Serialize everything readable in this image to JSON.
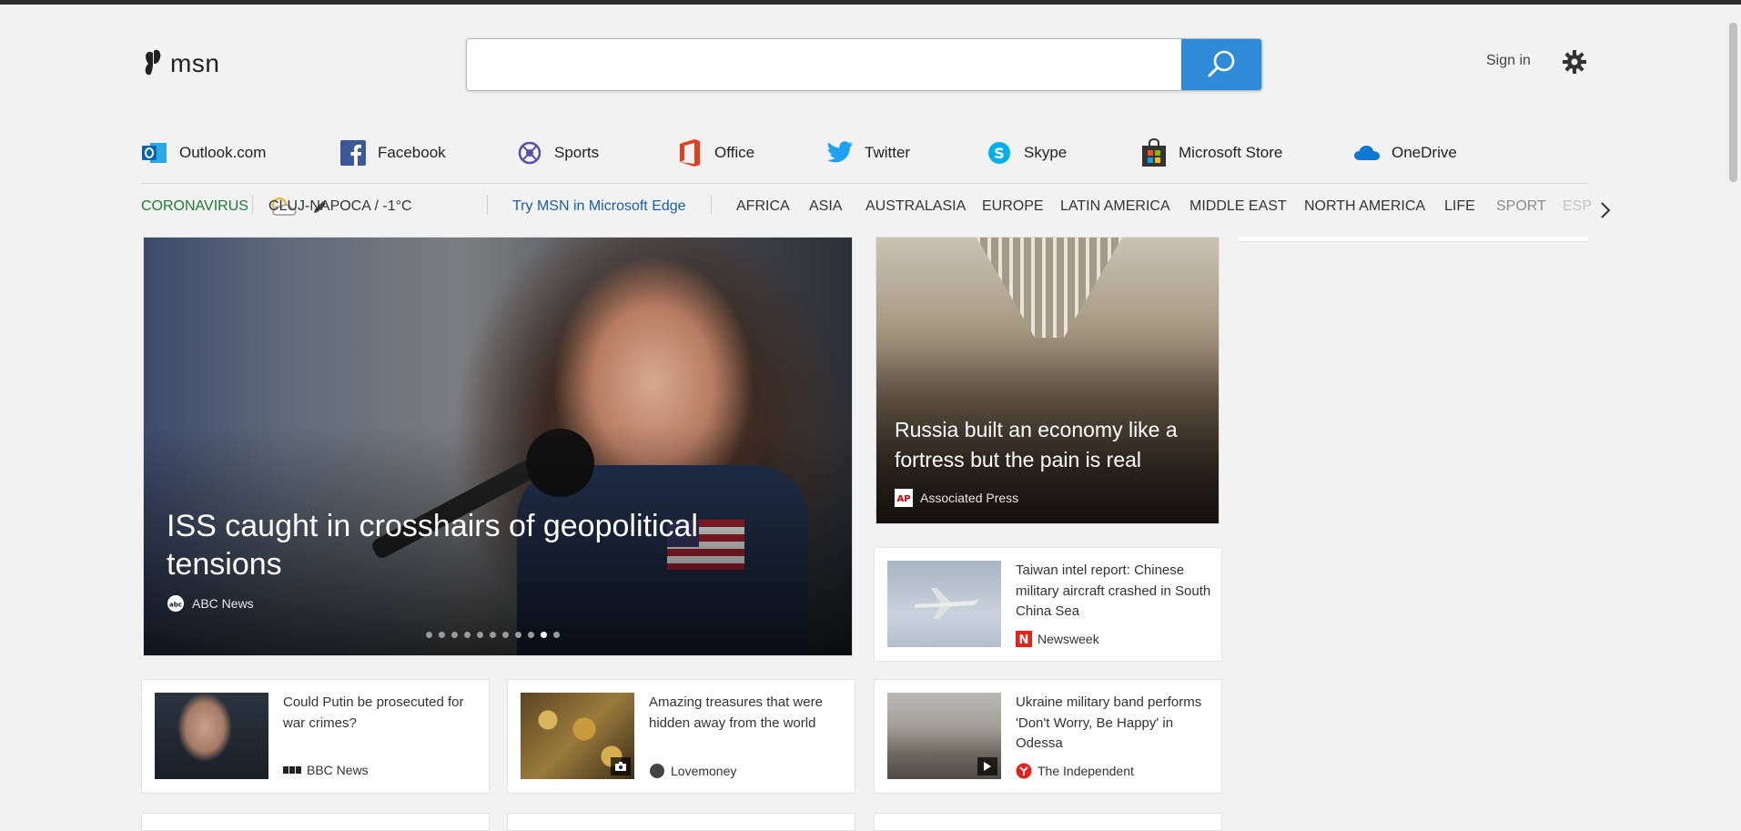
{
  "header": {
    "logo_text": "msn",
    "search_placeholder": "",
    "signin_label": "Sign in"
  },
  "quick_links": [
    {
      "label": "Outlook.com",
      "icon": "outlook-icon"
    },
    {
      "label": "Facebook",
      "icon": "facebook-icon"
    },
    {
      "label": "Sports",
      "icon": "sports-icon"
    },
    {
      "label": "Office",
      "icon": "office-icon"
    },
    {
      "label": "Twitter",
      "icon": "twitter-icon"
    },
    {
      "label": "Skype",
      "icon": "skype-icon"
    },
    {
      "label": "Microsoft Store",
      "icon": "microsoft-store-icon"
    },
    {
      "label": "OneDrive",
      "icon": "onedrive-icon"
    }
  ],
  "nav": {
    "coronavirus": "CORONAVIRUS",
    "weather": "CLUJ-NAPOCA / -1°C",
    "edge_promo": "Try MSN in Microsoft Edge",
    "categories": [
      "AFRICA",
      "ASIA",
      "AUSTRALASIA",
      "EUROPE",
      "LATIN AMERICA",
      "MIDDLE EAST",
      "NORTH AMERICA",
      "LIFE",
      "SPORT",
      "ESP"
    ]
  },
  "hero": {
    "title": "ISS caught in crosshairs of geopolitical tensions",
    "source": "ABC News",
    "slide_count": 11,
    "active_slide": 10
  },
  "feature": {
    "title": "Russia built an economy like a fortress but the pain is real",
    "source": "Associated Press"
  },
  "cards": [
    {
      "headline": "Taiwan intel report: Chinese military aircraft crashed in South China Sea",
      "source": "Newsweek"
    },
    {
      "headline": "Could Putin be prosecuted for war crimes?",
      "source": "BBC News"
    },
    {
      "headline": "Amazing treasures that were hidden away from the world",
      "source": "Lovemoney"
    },
    {
      "headline": "Ukraine military band performs 'Don't Worry, Be Happy' in Odessa",
      "source": "The Independent"
    }
  ],
  "colors": {
    "search_button": "#2f8bd9",
    "coronavirus": "#1d7d36",
    "edge_promo": "#1a5ea8",
    "page_bg": "#f2f2f2"
  }
}
